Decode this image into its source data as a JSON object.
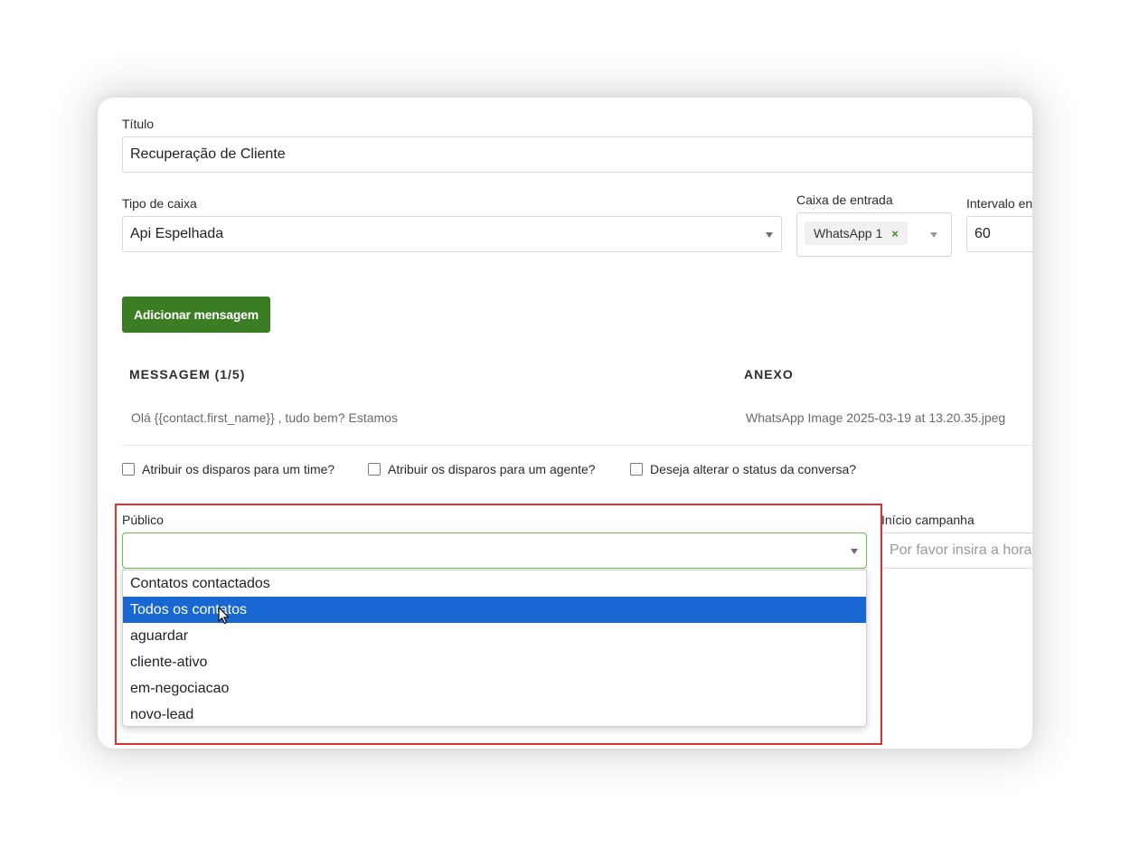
{
  "form": {
    "title_label": "Título",
    "title_value": "Recuperação de Cliente",
    "box_type_label": "Tipo de caixa",
    "box_type_value": "Api Espelhada",
    "inbox_label": "Caixa de entrada",
    "inbox_tag": "WhatsApp 1",
    "inbox_tag_remove": "×",
    "interval_label": "Intervalo en",
    "interval_value": "60",
    "add_message_button": "Adicionar mensagem"
  },
  "messages_table": {
    "col_message": "MESSAGEM (1/5)",
    "col_attachment": "ANEXO",
    "rows": [
      {
        "message": "Olá {{contact.first_name}} , tudo bem? Estamos",
        "attachment": "WhatsApp Image 2025-03-19 at 13.20.35.jpeg"
      }
    ]
  },
  "checkboxes": [
    {
      "label": "Atribuir os disparos para um time?",
      "checked": false
    },
    {
      "label": "Atribuir os disparos para um agente?",
      "checked": false
    },
    {
      "label": "Deseja alterar o status da conversa?",
      "checked": false
    }
  ],
  "audience": {
    "label": "Público",
    "value": "",
    "options": [
      {
        "label": "Contatos contactados",
        "selected": false
      },
      {
        "label": "Todos os contatos",
        "selected": true
      },
      {
        "label": "aguardar",
        "selected": false
      },
      {
        "label": "cliente-ativo",
        "selected": false
      },
      {
        "label": "em-negociacao",
        "selected": false
      },
      {
        "label": "novo-lead",
        "selected": false
      }
    ]
  },
  "campaign_start": {
    "label": "Início campanha",
    "placeholder": "Por favor insira a hora"
  },
  "colors": {
    "accent_green": "#3b7d22",
    "focus_green": "#6dbb52",
    "selected_blue": "#1967d2",
    "highlight_red": "#e03131"
  }
}
